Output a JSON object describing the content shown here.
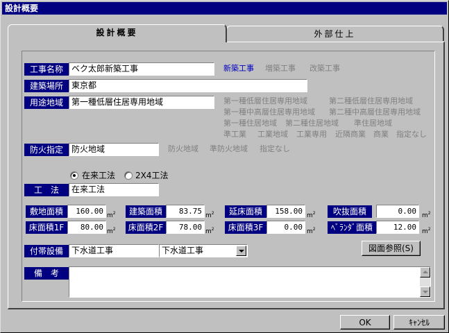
{
  "window": {
    "title": "設計概要"
  },
  "tabs": [
    {
      "label": "設計概要",
      "active": true
    },
    {
      "label": "外部仕上",
      "active": false
    }
  ],
  "project": {
    "name_label": "工事名称",
    "name_value": "ベク太郎新築工事",
    "types": [
      {
        "label": "新築工事",
        "selected": true
      },
      {
        "label": "増築工事",
        "selected": false
      },
      {
        "label": "改築工事",
        "selected": false
      }
    ]
  },
  "site": {
    "label": "建築場所",
    "value": "東京都"
  },
  "zoning": {
    "label": "用途地域",
    "value": "第一種低層住居専用地域",
    "options": [
      [
        "第一種低層住居専用地域",
        "第二種低層住居専用地域"
      ],
      [
        "第一種中高層住居専用地域",
        "第二種中高層住居専用地域"
      ],
      [
        "第一種住居地域",
        "第二種住居地域",
        "準住居地域"
      ],
      [
        "準工業",
        "工業地域",
        "工業専用",
        "近隣商業",
        "商業",
        "指定なし"
      ]
    ]
  },
  "fire": {
    "label": "防火指定",
    "value": "防火地域",
    "options": [
      "防火地域",
      "準防火地域",
      "指定なし"
    ]
  },
  "method": {
    "radios": [
      {
        "label": "在来工法",
        "checked": true
      },
      {
        "label": "2X4工法",
        "checked": false
      }
    ],
    "label": "工　法",
    "value": "在来工法"
  },
  "areas": {
    "unit": "m",
    "unit_sup": "2",
    "row1": [
      {
        "label": "敷地面積",
        "value": "160.00"
      },
      {
        "label": "建築面積",
        "value": "83.75"
      },
      {
        "label": "延床面積",
        "value": "158.00"
      },
      {
        "label": "吹抜面積",
        "value": "0.00"
      }
    ],
    "row2": [
      {
        "label": "床面積1F",
        "value": "80.00"
      },
      {
        "label": "床面積2F",
        "value": "78.00"
      },
      {
        "label": "床面積3F",
        "value": "0.00"
      },
      {
        "label": "ﾍﾞﾗﾝﾀﾞ面積",
        "value": "12.00"
      }
    ]
  },
  "equipment": {
    "label": "付帯設備",
    "value": "下水道工事",
    "select_value": "下水道工事",
    "ref_button": "図面参照(S)"
  },
  "remarks": {
    "label": "備　考",
    "value": ""
  },
  "footer": {
    "ok": "OK",
    "cancel": "ｷｬﾝｾﾙ"
  }
}
